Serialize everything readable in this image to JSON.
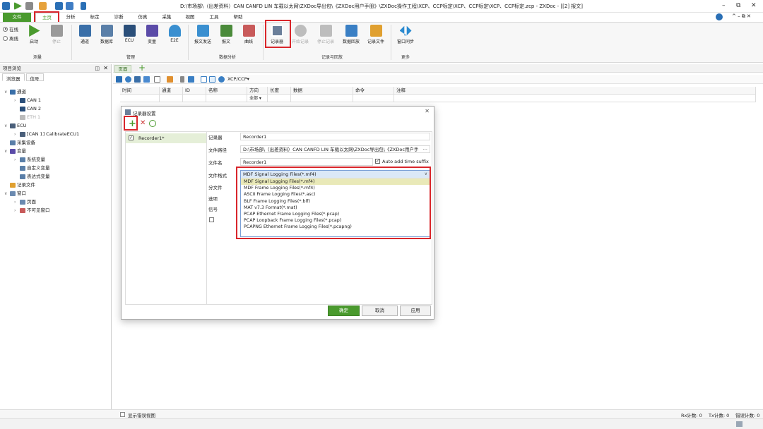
{
  "window": {
    "title": "D:\\市场部\\（出差资料）CAN CANFD LIN 车载以太网\\ZXDoc导出包\\《ZXDoc用户手册》\\ZXDoc操作工程\\XCP、CCP标定\\XCP、CCP标定\\XCP、CCP标定.zcp - ZXDoc - [[2] 报文]",
    "controls": [
      "–",
      "⧉",
      "✕"
    ],
    "mini_controls": "^ – ⧉ ✕"
  },
  "menu": {
    "items": [
      "文件",
      "主页",
      "分析",
      "标定",
      "诊断",
      "仿真",
      "采集",
      "视图",
      "工具",
      "帮助"
    ]
  },
  "ribbon": {
    "mode_online": "在线",
    "mode_offline": "离线",
    "buttons": {
      "start": "启动",
      "stop": "停止",
      "channel": "通道",
      "database": "数据库",
      "ecu": "ECU",
      "variable": "变量",
      "e2e": "E2E",
      "send": "报文发送",
      "message": "报文",
      "curve": "曲线",
      "recorder": "记录器",
      "start_record": "开始记录",
      "stop_record": "停止记录",
      "playback": "数据回放",
      "record_file": "记录文件",
      "window_sync": "窗口同步"
    },
    "groups": {
      "measure": "测量",
      "manage": "管理",
      "analysis": "数据分析",
      "record": "记录与回放",
      "more": "更多"
    }
  },
  "left_panel": {
    "title": "项目浏览",
    "tabs": [
      "浏览器",
      "信号"
    ],
    "tree": [
      {
        "label": "通道",
        "level": 0,
        "icon": "channel-icon"
      },
      {
        "label": "CAN 1",
        "level": 1,
        "icon": "can-icon"
      },
      {
        "label": "CAN 2",
        "level": 1,
        "icon": "can-icon"
      },
      {
        "label": "ETH 1",
        "level": 1,
        "icon": "eth-icon"
      },
      {
        "label": "ECU",
        "level": 0,
        "icon": "ecu-icon"
      },
      {
        "label": "[CAN 1] CalibrateECU1",
        "level": 1,
        "icon": "ecu-icon"
      },
      {
        "label": "采集设备",
        "level": 0,
        "icon": "device-icon"
      },
      {
        "label": "变量",
        "level": 0,
        "icon": "variable-icon"
      },
      {
        "label": "系统变量",
        "level": 1,
        "icon": "variable-icon"
      },
      {
        "label": "自定义变量",
        "level": 1,
        "icon": "variable-icon"
      },
      {
        "label": "表达式变量",
        "level": 1,
        "icon": "variable-icon"
      },
      {
        "label": "记录文件",
        "level": 0,
        "icon": "folder-icon"
      },
      {
        "label": "窗口",
        "level": 0,
        "icon": "window-icon"
      },
      {
        "label": "页面",
        "level": 1,
        "icon": "page-icon"
      },
      {
        "label": "不可见窗口",
        "level": 1,
        "icon": "hidden-window-icon"
      }
    ]
  },
  "page_tab": "页面",
  "toolbar2": {
    "xcp_label": "XCP/CCP▾"
  },
  "grid": {
    "columns": [
      "时间",
      "通道",
      "ID",
      "名称",
      "方向",
      "长度",
      "数据",
      "命令",
      "注释"
    ],
    "filter_direction": "全部"
  },
  "dialog": {
    "title": "记录器设置",
    "list_item": "Recorder1*",
    "fields": {
      "recorder_label": "记录器",
      "recorder_value": "Recorder1",
      "path_label": "文件路径",
      "path_value": "D:\\市场部\\（出差资料）CAN CANFD LIN 车载以太网\\ZXDoc导出包\\《ZXDoc用户手",
      "path_dots": "···",
      "filename_label": "文件名",
      "filename_value": "Recorder1",
      "auto_suffix": "Auto add time suffix",
      "format_label": "文件格式",
      "split_label": "分文件",
      "options_label": "选项",
      "signal_label": "信号"
    },
    "format_selected": "MDF Signal Logging Files(*.mf4)",
    "format_options": [
      "MDF Signal Logging Files(*.mf4)",
      "MDF Frame Logging Files(*.mf4)",
      "ASCII Frame Logging Files(*.asc)",
      "BLF Frame Logging Files(*.blf)",
      "MAT v7.3 Format(*.mat)",
      "PCAP Ethernet Frame Logging Files(*.pcap)",
      "PCAP Loopback Frame Logging Files(*.pcap)",
      "PCAPNG Ethernet Frame Logging Files(*.pcapng)"
    ],
    "buttons": {
      "ok": "确定",
      "cancel": "取消",
      "apply": "应用"
    }
  },
  "status": {
    "show_error_view": "显示错误视图",
    "rx": "Rx计数: 0",
    "tx": "Tx计数: 0",
    "err": "错误计数: 0"
  },
  "colors": {
    "accent": "#4a9a2e",
    "highlight": "#d9262b"
  }
}
